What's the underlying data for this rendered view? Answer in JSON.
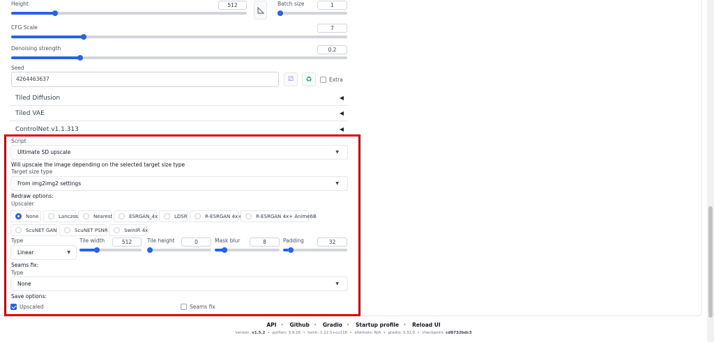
{
  "sliders": {
    "height": {
      "label": "Height",
      "value": "512",
      "fraction": 0.18
    },
    "batch_size": {
      "label": "Batch size",
      "value": "1",
      "fraction": 0.0
    },
    "cfg_scale": {
      "label": "CFG Scale",
      "value": "7",
      "fraction": 0.21
    },
    "denoising": {
      "label": "Denoising strength",
      "value": "0.2",
      "fraction": 0.2
    }
  },
  "seed": {
    "label": "Seed",
    "value": "4264463637",
    "extra_label": "Extra",
    "dice_icon": "dice-icon",
    "recycle_icon": "recycle-icon"
  },
  "accordions": [
    {
      "title": "Tiled Diffusion"
    },
    {
      "title": "Tiled VAE"
    },
    {
      "title": "ControlNet v1.1.313"
    }
  ],
  "script": {
    "label": "Script",
    "selected": "Ultimate SD upscale",
    "description": "Will upscale the image depending on the selected target size type",
    "target_size_label": "Target size type",
    "target_size_selected": "From img2img2 settings",
    "redraw_label": "Redraw options:",
    "upscaler_label": "Upscaler",
    "upscalers_row1": [
      "None",
      "Lanczos",
      "Nearest",
      "ESRGAN_4x",
      "LDSR",
      "R-ESRGAN 4x+",
      "R-ESRGAN 4x+ Anime6B"
    ],
    "upscalers_row2": [
      "ScuNET GAN",
      "ScuNET PSNR",
      "SwinIR 4x"
    ],
    "upscaler_selected": "None",
    "type_label": "Type",
    "type_selected": "Linear",
    "tile_width": {
      "label": "Tile width",
      "value": "512",
      "fraction": 0.26
    },
    "tile_height": {
      "label": "Tile height",
      "value": "0",
      "fraction": 0.0
    },
    "mask_blur": {
      "label": "Mask blur",
      "value": "8",
      "fraction": 0.12
    },
    "padding": {
      "label": "Padding",
      "value": "32",
      "fraction": 0.08
    },
    "seams_fix_label": "Seams fix:",
    "seams_type_label": "Type",
    "seams_type_selected": "None",
    "save_label": "Save options:",
    "save_upscaled": {
      "label": "Upscaled",
      "checked": true
    },
    "save_seams": {
      "label": "Seams fix",
      "checked": false
    }
  },
  "footer": {
    "links": [
      "API",
      "Github",
      "Gradio",
      "Startup profile",
      "Reload UI"
    ],
    "version_prefix": "version:",
    "version": "v1.5.2",
    "python": "python: 3.9.16",
    "torch": "torch: 1.12.1+cu116",
    "xformers": "xformers: N/A",
    "gradio": "gradio: 3.32.0",
    "checkpoint_prefix": "checkpoint:",
    "checkpoint": "cd8732bdc3"
  },
  "colors": {
    "accent": "#2563eb",
    "highlight": "#e00000"
  }
}
